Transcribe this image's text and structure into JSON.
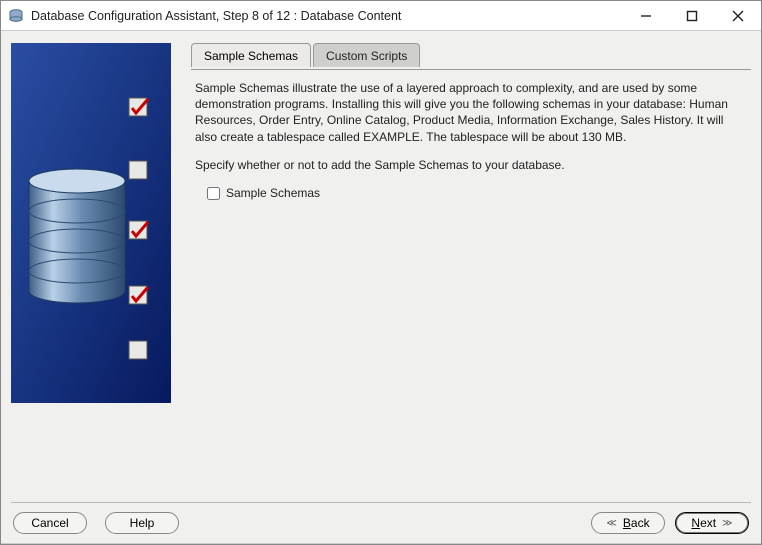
{
  "window": {
    "title": "Database Configuration Assistant, Step 8 of 12 : Database Content"
  },
  "tabs": {
    "sample": "Sample Schemas",
    "custom": "Custom Scripts"
  },
  "content": {
    "desc": "Sample Schemas illustrate the use of a layered approach to complexity, and are used by some demonstration programs. Installing this will give you the following schemas in your database: Human Resources, Order Entry, Online Catalog, Product Media, Information Exchange, Sales History. It will also create a tablespace called EXAMPLE. The tablespace will be about 130 MB.",
    "instruction": "Specify whether or not to add the Sample Schemas to your database.",
    "checkbox_label": "Sample Schemas"
  },
  "buttons": {
    "cancel": "Cancel",
    "help": "Help",
    "back_prefix": "B",
    "back_rest": "ack",
    "next_prefix": "N",
    "next_rest": "ext"
  }
}
